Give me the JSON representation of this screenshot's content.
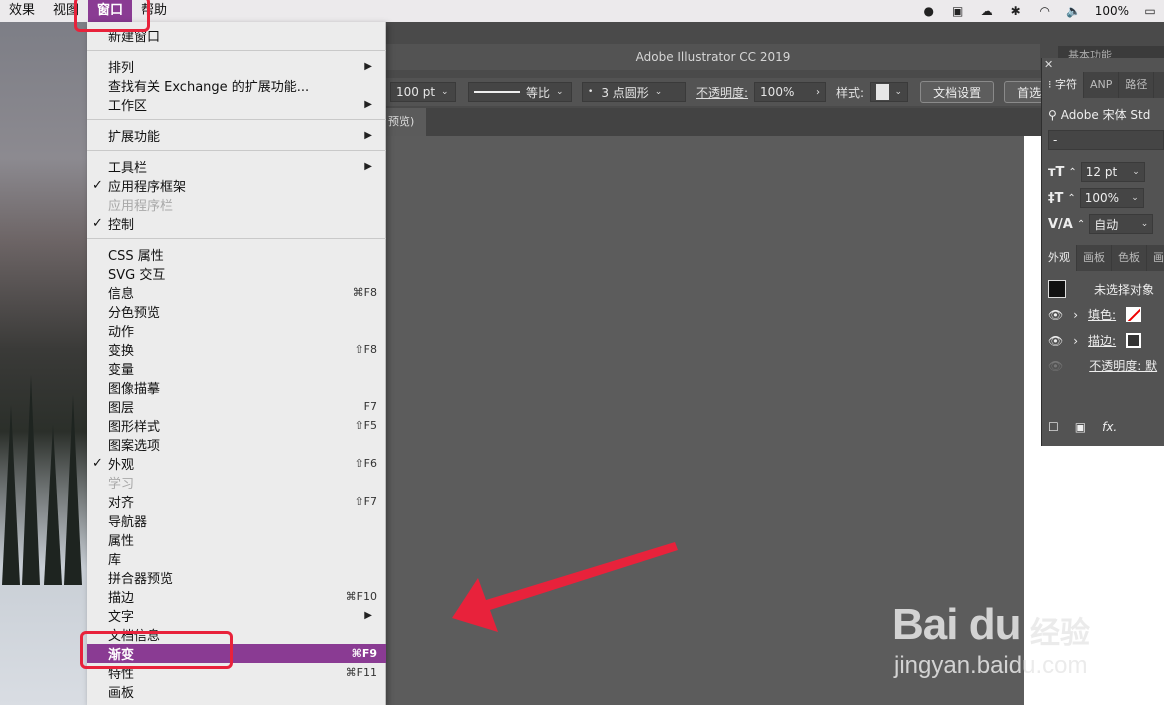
{
  "menubar": {
    "items": [
      "效果",
      "视图",
      "窗口",
      "帮助"
    ],
    "active_index": 2,
    "battery": "100%"
  },
  "app": {
    "title": "Adobe Illustrator CC 2019",
    "workspace": "基本功能",
    "doc_tab": "预览)"
  },
  "control_bar": {
    "stroke_weight": "100 pt",
    "stroke_profile": "等比",
    "brush": "3 点圆形",
    "opacity_label": "不透明度:",
    "opacity_value": "100%",
    "style_label": "样式:",
    "doc_setup_button": "文档设置",
    "prefs_button": "首选"
  },
  "character_panel": {
    "tabs": [
      "字符",
      "ANP",
      "路径"
    ],
    "font": "Adobe 宋体 Std",
    "font_style": "-",
    "size": "12 pt",
    "leading": "100%",
    "tracking": "自动"
  },
  "appearance_panel": {
    "tabs": [
      "外观",
      "画板",
      "色板",
      "画笔"
    ],
    "no_selection": "未选择对象",
    "fill_label": "填色:",
    "stroke_label": "描边:",
    "opacity_label": "不透明度: 默"
  },
  "window_menu": {
    "items": [
      {
        "label": "新建窗口",
        "check": "",
        "shortcut": "",
        "submenu": false,
        "disabled": false
      },
      {
        "label": "排列",
        "check": "",
        "shortcut": "",
        "submenu": true,
        "disabled": false
      },
      {
        "label": "查找有关 Exchange 的扩展功能...",
        "check": "",
        "shortcut": "",
        "submenu": false,
        "disabled": false
      },
      {
        "label": "工作区",
        "check": "",
        "shortcut": "",
        "submenu": true,
        "disabled": false
      },
      {
        "label": "扩展功能",
        "check": "",
        "shortcut": "",
        "submenu": true,
        "disabled": false
      },
      {
        "label": "工具栏",
        "check": "",
        "shortcut": "",
        "submenu": true,
        "disabled": false
      },
      {
        "label": "应用程序框架",
        "check": "✓",
        "shortcut": "",
        "submenu": false,
        "disabled": false
      },
      {
        "label": "应用程序栏",
        "check": "",
        "shortcut": "",
        "submenu": false,
        "disabled": true
      },
      {
        "label": "控制",
        "check": "✓",
        "shortcut": "",
        "submenu": false,
        "disabled": false
      },
      {
        "label": "CSS 属性",
        "check": "",
        "shortcut": "",
        "submenu": false,
        "disabled": false
      },
      {
        "label": "SVG 交互",
        "check": "",
        "shortcut": "",
        "submenu": false,
        "disabled": false
      },
      {
        "label": "信息",
        "check": "",
        "shortcut": "⌘F8",
        "submenu": false,
        "disabled": false
      },
      {
        "label": "分色预览",
        "check": "",
        "shortcut": "",
        "submenu": false,
        "disabled": false
      },
      {
        "label": "动作",
        "check": "",
        "shortcut": "",
        "submenu": false,
        "disabled": false
      },
      {
        "label": "变换",
        "check": "",
        "shortcut": "⇧F8",
        "submenu": false,
        "disabled": false
      },
      {
        "label": "变量",
        "check": "",
        "shortcut": "",
        "submenu": false,
        "disabled": false
      },
      {
        "label": "图像描摹",
        "check": "",
        "shortcut": "",
        "submenu": false,
        "disabled": false
      },
      {
        "label": "图层",
        "check": "",
        "shortcut": "F7",
        "submenu": false,
        "disabled": false
      },
      {
        "label": "图形样式",
        "check": "",
        "shortcut": "⇧F5",
        "submenu": false,
        "disabled": false
      },
      {
        "label": "图案选项",
        "check": "",
        "shortcut": "",
        "submenu": false,
        "disabled": false
      },
      {
        "label": "外观",
        "check": "✓",
        "shortcut": "⇧F6",
        "submenu": false,
        "disabled": false
      },
      {
        "label": "学习",
        "check": "",
        "shortcut": "",
        "submenu": false,
        "disabled": true
      },
      {
        "label": "对齐",
        "check": "",
        "shortcut": "⇧F7",
        "submenu": false,
        "disabled": false
      },
      {
        "label": "导航器",
        "check": "",
        "shortcut": "",
        "submenu": false,
        "disabled": false
      },
      {
        "label": "属性",
        "check": "",
        "shortcut": "",
        "submenu": false,
        "disabled": false
      },
      {
        "label": "库",
        "check": "",
        "shortcut": "",
        "submenu": false,
        "disabled": false
      },
      {
        "label": "拼合器预览",
        "check": "",
        "shortcut": "",
        "submenu": false,
        "disabled": false
      },
      {
        "label": "描边",
        "check": "",
        "shortcut": "⌘F10",
        "submenu": false,
        "disabled": false
      },
      {
        "label": "文字",
        "check": "",
        "shortcut": "",
        "submenu": true,
        "disabled": false
      },
      {
        "label": "文档信息",
        "check": "",
        "shortcut": "",
        "submenu": false,
        "disabled": false
      },
      {
        "label": "渐变",
        "check": "",
        "shortcut": "⌘F9",
        "submenu": false,
        "disabled": false,
        "highlighted": true
      },
      {
        "label": "特性",
        "check": "",
        "shortcut": "⌘F11",
        "submenu": false,
        "disabled": false
      },
      {
        "label": "画板",
        "check": "",
        "shortcut": "",
        "submenu": false,
        "disabled": false
      }
    ]
  },
  "colors": {
    "highlight": "#8a3b93",
    "annotation_red": "#e8223b"
  },
  "watermark": {
    "logo": "Bai du",
    "cn": "经验",
    "url": "jingyan.baidu.com"
  }
}
